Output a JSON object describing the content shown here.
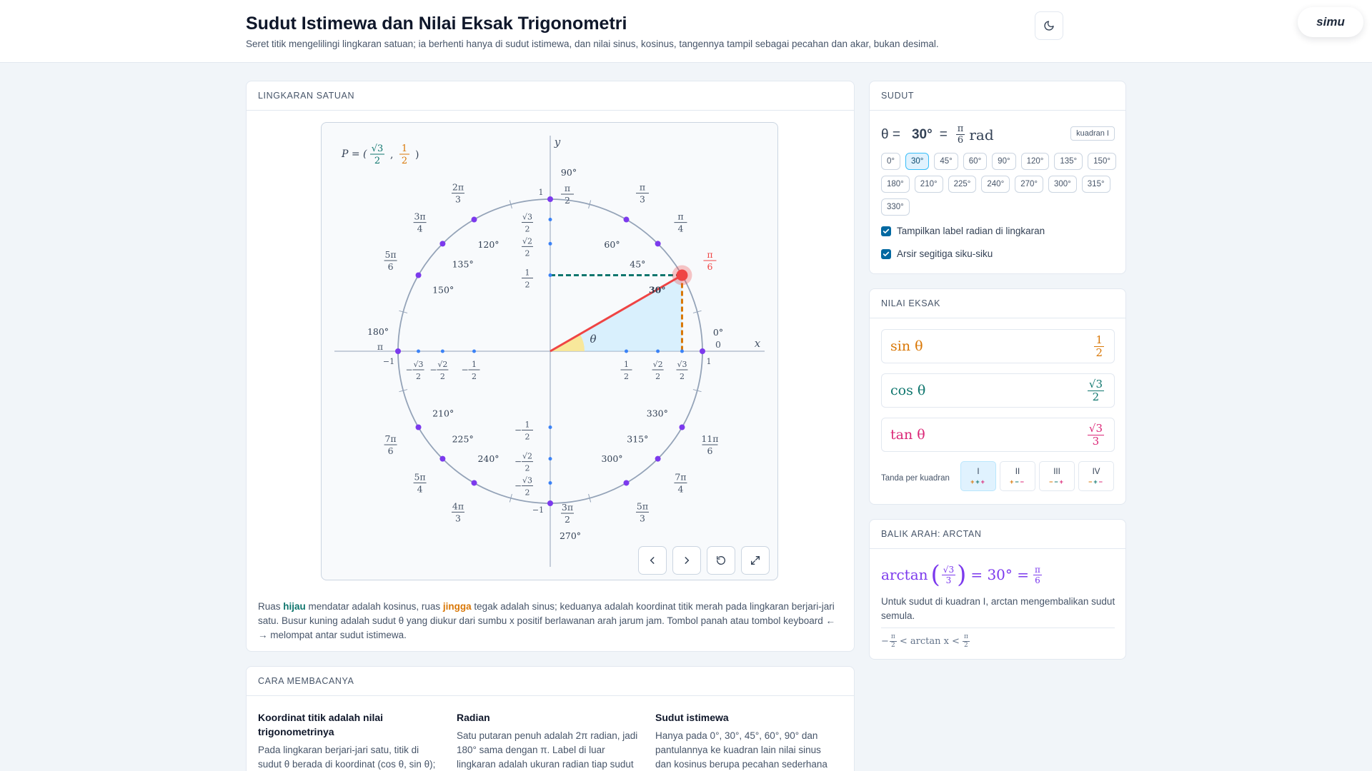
{
  "header": {
    "title": "Sudut Istimewa dan Nilai Eksak Trigonometri",
    "subtitle": "Seret titik mengelilingi lingkaran satuan; ia berhenti hanya di sudut istimewa, dan nilai sinus, kosinus, tangennya tampil sebagai pecahan dan akar, bukan desimal.",
    "logo_text": "simu"
  },
  "circle_card": {
    "heading": "LINGKARAN SATUAN",
    "point_label": "P = (",
    "point_x_num": "√3",
    "point_x_den": "2",
    "point_y_num": "1",
    "point_y_den": "2",
    "axis_x": "x",
    "axis_y": "y",
    "theta_symbol": "θ",
    "current_deg_label": "30°",
    "current_rad_num": "π",
    "current_rad_den": "6",
    "angles": [
      {
        "deg": 0,
        "label": "0°",
        "rad": "0"
      },
      {
        "deg": 30,
        "label": "30°",
        "rad_num": "π",
        "rad_den": "6"
      },
      {
        "deg": 45,
        "label": "45°",
        "rad_num": "π",
        "rad_den": "4"
      },
      {
        "deg": 60,
        "label": "60°",
        "rad_num": "π",
        "rad_den": "3"
      },
      {
        "deg": 90,
        "label": "90°",
        "rad_num": "π",
        "rad_den": "2"
      },
      {
        "deg": 120,
        "label": "120°",
        "rad_num": "2π",
        "rad_den": "3"
      },
      {
        "deg": 135,
        "label": "135°",
        "rad_num": "3π",
        "rad_den": "4"
      },
      {
        "deg": 150,
        "label": "150°",
        "rad_num": "5π",
        "rad_den": "6"
      },
      {
        "deg": 180,
        "label": "180°",
        "rad": "π"
      },
      {
        "deg": 210,
        "label": "210°",
        "rad_num": "7π",
        "rad_den": "6"
      },
      {
        "deg": 225,
        "label": "225°",
        "rad_num": "5π",
        "rad_den": "4"
      },
      {
        "deg": 240,
        "label": "240°",
        "rad_num": "4π",
        "rad_den": "3"
      },
      {
        "deg": 270,
        "label": "270°",
        "rad_num": "3π",
        "rad_den": "2"
      },
      {
        "deg": 300,
        "label": "300°",
        "rad_num": "5π",
        "rad_den": "3"
      },
      {
        "deg": 315,
        "label": "315°",
        "rad_num": "7π",
        "rad_den": "4"
      },
      {
        "deg": 330,
        "label": "330°",
        "rad_num": "11π",
        "rad_den": "6"
      }
    ],
    "axis_ticks": {
      "one": "1",
      "neg_one": "−1",
      "half_num": "1",
      "half_den": "2",
      "r2_num": "√2",
      "r3_num": "√3",
      "den": "2",
      "neg": "−"
    },
    "description": {
      "part1": "Ruas ",
      "green": "hijau",
      "part2": " mendatar adalah kosinus, ruas ",
      "orange": "jingga",
      "part3": " tegak adalah sinus; keduanya adalah koordinat titik merah pada lingkaran berjari-jari satu. Busur kuning adalah sudut θ yang diukur dari sumbu x positif berlawanan arah jarum jam. Tombol panah atau tombol keyboard ← → melompat antar sudut istimewa."
    }
  },
  "reading_card": {
    "heading": "CARA MEMBACANYA",
    "columns": [
      {
        "title": "Koordinat titik adalah nilai trigonometrinya",
        "body": "Pada lingkaran berjari-jari satu, titik di sudut θ berada di koordinat (cos θ, sin θ);"
      },
      {
        "title": "Radian",
        "body": "Satu putaran penuh adalah 2π radian, jadi 180° sama dengan π. Label di luar lingkaran adalah ukuran radian tiap sudut"
      },
      {
        "title": "Sudut istimewa",
        "body": "Hanya pada 0°, 30°, 45°, 60°, 90° dan pantulannya ke kuadran lain nilai sinus dan kosinus berupa pecahan sederhana"
      }
    ]
  },
  "angle_card": {
    "heading": "SUDUT",
    "theta_prefix": "θ =",
    "deg_value": "30°",
    "equals": "=",
    "rad_num": "π",
    "rad_den": "6",
    "rad_unit": "rad",
    "quadrant_badge": "kuadran I",
    "chips": [
      "0°",
      "30°",
      "45°",
      "60°",
      "90°",
      "120°",
      "135°",
      "150°",
      "180°",
      "210°",
      "225°",
      "240°",
      "270°",
      "300°",
      "315°",
      "330°"
    ],
    "active_chip": "30°",
    "checkbox_radian": "Tampilkan label radian di lingkaran",
    "checkbox_triangle": "Arsir segitiga siku-siku"
  },
  "exact_card": {
    "heading": "NILAI EKSAK",
    "sin_label": "sin θ",
    "sin_num": "1",
    "sin_den": "2",
    "cos_label": "cos θ",
    "cos_num": "√3",
    "cos_den": "2",
    "tan_label": "tan θ",
    "tan_num": "√3",
    "tan_den": "3",
    "sign_label": "Tanda per kuadran",
    "quadrants": [
      {
        "name": "I",
        "signs": [
          "+",
          "+",
          "+"
        ]
      },
      {
        "name": "II",
        "signs": [
          "+",
          "−",
          "−"
        ]
      },
      {
        "name": "III",
        "signs": [
          "−",
          "−",
          "+"
        ]
      },
      {
        "name": "IV",
        "signs": [
          "−",
          "+",
          "−"
        ]
      }
    ]
  },
  "arctan_card": {
    "heading": "BALIK ARAH: ARCTAN",
    "fn": "arctan",
    "arg_num": "√3",
    "arg_den": "3",
    "eq_deg": "= 30° =",
    "res_num": "π",
    "res_den": "6",
    "note": "Untuk sudut di kuadran I, arctan mengembalikan sudut semula.",
    "range_left": "−",
    "range_mid": "< arctan x <",
    "range_num": "π",
    "range_den": "2"
  },
  "colors": {
    "cos": "#0f766e",
    "sin": "#d97706",
    "tan": "#db2777",
    "point": "#ef4444",
    "accent": "#7c3aed",
    "arc": "#fde68a"
  }
}
